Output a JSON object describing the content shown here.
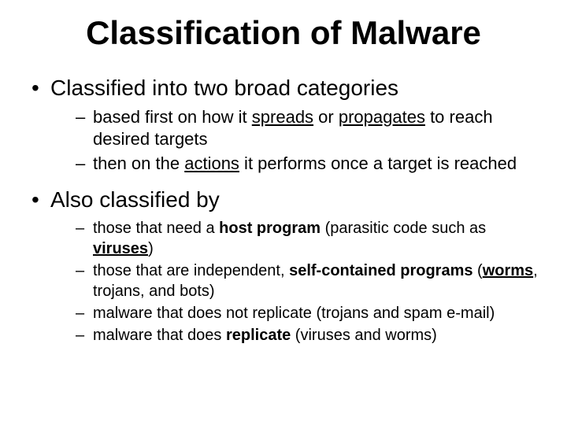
{
  "title": "Classification of Malware",
  "bullets": [
    {
      "text": "Classified into two broad categories",
      "sub": [
        {
          "pre": "based first on how it ",
          "k1": "spreads",
          "mid": " or ",
          "k2": "propagates",
          "post": " to reach desired targets"
        },
        {
          "pre": "then on the ",
          "k1": "actions",
          "mid": "",
          "k2": "",
          "post": " it performs once a target is reached"
        }
      ]
    },
    {
      "text": "Also classified by",
      "sub": [
        {
          "pre": "those that need a ",
          "b1": "host program",
          "mid": " (parasitic code such as ",
          "u1": "viruses",
          "post": ")"
        },
        {
          "pre": "those that are independent, ",
          "b1": "self-contained programs",
          "mid": " (",
          "u1": "worms",
          "post2": ", trojans, and bots)"
        },
        {
          "plain": "malware that does not replicate (trojans and spam e-mail)"
        },
        {
          "pre": "malware that does ",
          "b1": "replicate",
          "post": " (viruses and worms)"
        }
      ]
    }
  ]
}
